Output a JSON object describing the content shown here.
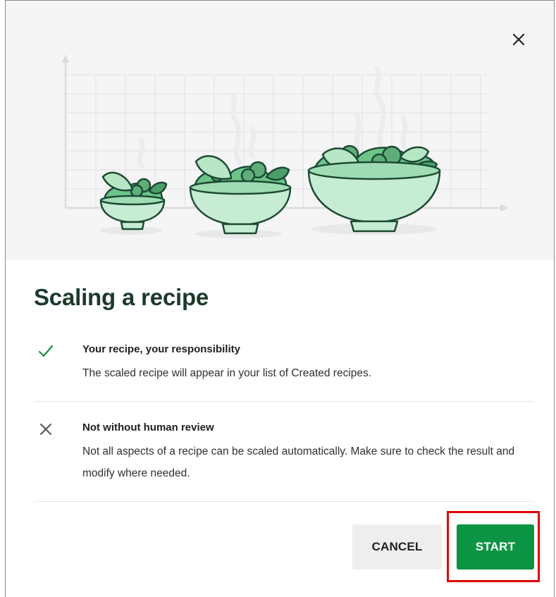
{
  "dialog": {
    "title": "Scaling a recipe",
    "close_icon": "close-icon",
    "items": [
      {
        "icon": "check-icon",
        "heading": "Your recipe, your responsibility",
        "text": "The scaled recipe will appear in your list of Created recipes."
      },
      {
        "icon": "cross-icon",
        "heading": "Not without human review",
        "text": "Not all aspects of a recipe can be scaled automatically. Make sure to check the result and modify where needed."
      }
    ],
    "buttons": {
      "cancel": "CANCEL",
      "start": "START"
    }
  },
  "colors": {
    "accent_green": "#0b9444",
    "title_color": "#1c3a2c",
    "check_color": "#1b8a4a",
    "highlight_red": "#e00000"
  }
}
